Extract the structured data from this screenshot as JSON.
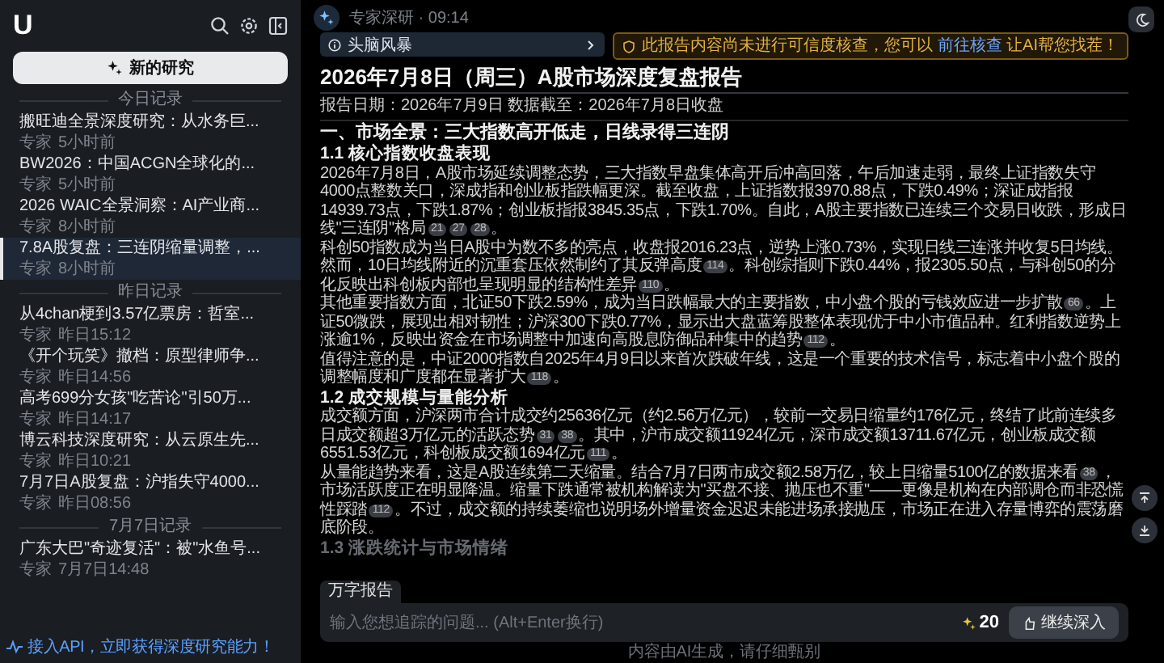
{
  "sidebar": {
    "logo": "U",
    "new_button": "新的研究",
    "sections": [
      {
        "title": "今日记录",
        "items": [
          {
            "title": "搬旺迪全景深度研究：从水务巨...",
            "author": "专家",
            "time": "5小时前",
            "selected": false
          },
          {
            "title": "BW2026：中国ACGN全球化的...",
            "author": "专家",
            "time": "5小时前",
            "selected": false
          },
          {
            "title": "2026 WAIC全景洞察：AI产业商...",
            "author": "专家",
            "time": "8小时前",
            "selected": false
          },
          {
            "title": "7.8A股复盘：三连阴缩量调整，...",
            "author": "专家",
            "time": "8小时前",
            "selected": true
          }
        ]
      },
      {
        "title": "昨日记录",
        "items": [
          {
            "title": "从4chan梗到3.57亿票房：哲室...",
            "author": "专家",
            "time": "昨日15:12",
            "selected": false
          },
          {
            "title": "《开个玩笑》撤档：原型律师争...",
            "author": "专家",
            "time": "昨日14:56",
            "selected": false
          },
          {
            "title": "高考699分女孩\"吃苦论\"引50万...",
            "author": "专家",
            "time": "昨日14:17",
            "selected": false
          },
          {
            "title": "博云科技深度研究：从云原生先...",
            "author": "专家",
            "time": "昨日10:21",
            "selected": false
          },
          {
            "title": "7月7日A股复盘：沪指失守4000...",
            "author": "专家",
            "time": "昨日08:56",
            "selected": false
          }
        ]
      },
      {
        "title": "7月7日记录",
        "items": [
          {
            "title": "广东大巴\"奇迹复活\"：被\"水鱼号...",
            "author": "专家",
            "time": "7月7日14:48",
            "selected": false
          }
        ]
      }
    ],
    "api_banner": "接入API，立即获得深度研究能力！"
  },
  "message": {
    "meta": "专家深研 · 09:14",
    "brainstorm": "头脑风暴",
    "warning": {
      "before": "此报告内容尚未进行可信度核查，您可以",
      "link": "前往核查",
      "after": "让AI帮您找茬！"
    },
    "title": "2026年7月8日（周三）A股市场深度复盘报告",
    "report_meta": "报告日期：2026年7月9日 数据截至：2026年7月8日收盘",
    "blocks": [
      {
        "kind": "h2",
        "text": "一、市场全景：三大指数高开低走，日线录得三连阴"
      },
      {
        "kind": "h3",
        "text": "1.1 核心指数收盘表现"
      },
      {
        "kind": "p",
        "parts": [
          {
            "kind": "text",
            "text": "2026年7月8日，A股市场延续调整态势，三大指数早盘集体高开后冲高回落，午后加速走弱，最终上证指数失守4000点整数关口，深成指和创业板指跌幅更深。截至收盘，上证指数报3970.88点，下跌0.49%；深证成指报14939.73点，下跌1.87%；创业板指报3845.35点，下跌1.70%。自此，A股主要指数已连续三个交易日收跌，形成日线\"三连阴\"格局"
          },
          {
            "kind": "cite",
            "text": "21"
          },
          {
            "kind": "cite",
            "text": "27"
          },
          {
            "kind": "cite",
            "text": "28"
          },
          {
            "kind": "text",
            "text": "。"
          }
        ]
      },
      {
        "kind": "p",
        "parts": [
          {
            "kind": "text",
            "text": "科创50指数成为当日A股中为数不多的亮点，收盘报2016.23点，逆势上涨0.73%，实现日线三连涨并收复5日均线。然而，10日均线附近的沉重套压依然制约了其反弹高度"
          },
          {
            "kind": "cite",
            "text": "114"
          },
          {
            "kind": "text",
            "text": "。科创综指则下跌0.44%，报2305.50点，与科创50的分化反映出科创板内部也呈现明显的结构性差异"
          },
          {
            "kind": "cite",
            "text": "110"
          },
          {
            "kind": "text",
            "text": "。"
          }
        ]
      },
      {
        "kind": "p",
        "parts": [
          {
            "kind": "text",
            "text": "其他重要指数方面，北证50下跌2.59%，成为当日跌幅最大的主要指数，中小盘个股的亏钱效应进一步扩散"
          },
          {
            "kind": "cite",
            "text": "66"
          },
          {
            "kind": "text",
            "text": "。上证50微跌，展现出相对韧性；沪深300下跌0.77%，显示出大盘蓝筹股整体表现优于中小市值品种。红利指数逆势上涨逾1%，反映出资金在市场调整中加速向高股息防御品种集中的趋势"
          },
          {
            "kind": "cite",
            "text": "112"
          },
          {
            "kind": "text",
            "text": "。"
          }
        ]
      },
      {
        "kind": "p",
        "parts": [
          {
            "kind": "text",
            "text": "值得注意的是，中证2000指数自2025年4月9日以来首次跌破年线，这是一个重要的技术信号，标志着中小盘个股的调整幅度和广度都在显著扩大"
          },
          {
            "kind": "cite",
            "text": "118"
          },
          {
            "kind": "text",
            "text": "。"
          }
        ]
      },
      {
        "kind": "h3",
        "text": "1.2 成交规模与量能分析"
      },
      {
        "kind": "p",
        "parts": [
          {
            "kind": "text",
            "text": "成交额方面，沪深两市合计成交约25636亿元（约2.56万亿元），较前一交易日缩量约176亿元，终结了此前连续多日成交额超3万亿元的活跃态势"
          },
          {
            "kind": "cite",
            "text": "31"
          },
          {
            "kind": "cite",
            "text": "38"
          },
          {
            "kind": "text",
            "text": "。其中，沪市成交额11924亿元，深市成交额13711.67亿元，创业板成交额6551.53亿元，科创板成交额1694亿元"
          },
          {
            "kind": "cite",
            "text": "111"
          },
          {
            "kind": "text",
            "text": "。"
          }
        ]
      },
      {
        "kind": "p",
        "parts": [
          {
            "kind": "text",
            "text": "从量能趋势来看，这是A股连续第二天缩量。结合7月7日两市成交额2.58万亿，较上日缩量5100亿的数据来看"
          },
          {
            "kind": "cite",
            "text": "38"
          },
          {
            "kind": "text",
            "text": "，市场活跃度正在明显降温。缩量下跌通常被机构解读为\"买盘不接、抛压也不重\"——更像是机构在内部调仓而非恐慌性踩踏"
          },
          {
            "kind": "cite",
            "text": "112"
          },
          {
            "kind": "text",
            "text": "。不过，成交额的持续萎缩也说明场外增量资金迟迟未能进场承接抛压，市场正在进入存量博弈的震荡磨底阶段。"
          }
        ]
      },
      {
        "kind": "h3",
        "text": "1.3 涨跌统计与市场情绪"
      }
    ]
  },
  "composer": {
    "mode_tag": "万字报告",
    "placeholder": "输入您想追踪的问题... (Alt+Enter换行)",
    "credits": "20",
    "submit": "继续深入"
  },
  "footer": "内容由AI生成，请仔细甄别"
}
